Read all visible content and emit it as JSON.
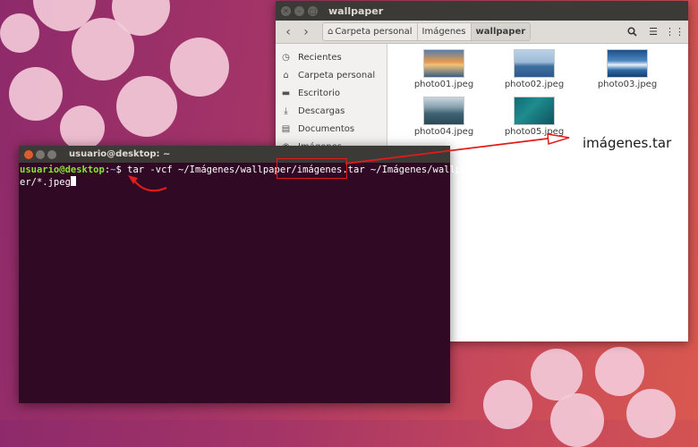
{
  "file_manager": {
    "window_title": "wallpaper",
    "breadcrumbs": [
      "Carpeta personal",
      "Imágenes",
      "wallpaper"
    ],
    "sidebar": [
      {
        "label": "Recientes",
        "icon": "clock-icon"
      },
      {
        "label": "Carpeta personal",
        "icon": "home-icon"
      },
      {
        "label": "Escritorio",
        "icon": "desktop-icon"
      },
      {
        "label": "Descargas",
        "icon": "download-icon"
      },
      {
        "label": "Documentos",
        "icon": "document-icon"
      },
      {
        "label": "Imágenes",
        "icon": "camera-icon"
      }
    ],
    "files": [
      {
        "name": "photo01.jpeg"
      },
      {
        "name": "photo02.jpeg"
      },
      {
        "name": "photo03.jpeg"
      },
      {
        "name": "photo04.jpeg"
      },
      {
        "name": "photo05.jpeg"
      }
    ],
    "archive": {
      "name": "imágenes.tar",
      "icon_label": "tar"
    }
  },
  "terminal": {
    "window_title": "usuario@desktop: ~",
    "prompt_user": "usuario@desktop",
    "prompt_sep": ":",
    "prompt_path": "~",
    "prompt_symbol": "$",
    "cmd_before": " tar -vcf ~/Imágenes/wallpaper/",
    "cmd_highlight": "imágenes.tar",
    "cmd_after": " ~/Imágenes/wallpap",
    "line2": "er/*.jpeg"
  },
  "colors": {
    "annotation": "#e21b1b",
    "terminal_bg": "#300a24"
  }
}
